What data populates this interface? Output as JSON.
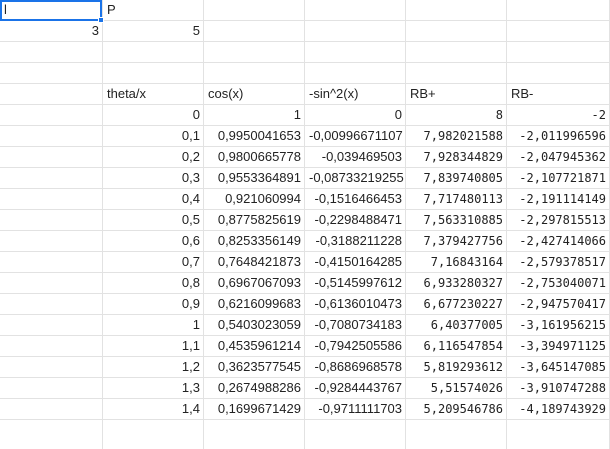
{
  "top": {
    "a1": "l",
    "b1": "P",
    "a2": "3",
    "b2": "5"
  },
  "headers": [
    "theta/x",
    "cos(x)",
    "-sin^2(x)",
    "RB+",
    "RB-"
  ],
  "rows": [
    [
      "0",
      "1",
      "0",
      "8",
      "-2"
    ],
    [
      "0,1",
      "0,9950041653",
      "-0,00996671107",
      "7,982021588",
      "-2,011996596"
    ],
    [
      "0,2",
      "0,9800665778",
      "-0,039469503",
      "7,928344829",
      "-2,047945362"
    ],
    [
      "0,3",
      "0,9553364891",
      "-0,08733219255",
      "7,839740805",
      "-2,107721871"
    ],
    [
      "0,4",
      "0,921060994",
      "-0,1516466453",
      "7,717480113",
      "-2,191114149"
    ],
    [
      "0,5",
      "0,8775825619",
      "-0,2298488471",
      "7,563310885",
      "-2,297815513"
    ],
    [
      "0,6",
      "0,8253356149",
      "-0,3188211228",
      "7,379427756",
      "-2,427414066"
    ],
    [
      "0,7",
      "0,7648421873",
      "-0,4150164285",
      "7,16843164",
      "-2,579378517"
    ],
    [
      "0,8",
      "0,6967067093",
      "-0,5145997612",
      "6,933280327",
      "-2,753040071"
    ],
    [
      "0,9",
      "0,6216099683",
      "-0,6136010473",
      "6,677230227",
      "-2,947570417"
    ],
    [
      "1",
      "0,5403023059",
      "-0,7080734183",
      "6,40377005",
      "-3,161956215"
    ],
    [
      "1,1",
      "0,4535961214",
      "-0,7942505586",
      "6,116547854",
      "-3,394971125"
    ],
    [
      "1,2",
      "0,3623577545",
      "-0,8686968578",
      "5,819293612",
      "-3,645147085"
    ],
    [
      "1,3",
      "0,2674988286",
      "-0,9284443767",
      "5,51574026",
      "-3,910747288"
    ],
    [
      "1,4",
      "0,1699671429",
      "-0,9711111703",
      "5,209546786",
      "-4,189743929"
    ]
  ]
}
